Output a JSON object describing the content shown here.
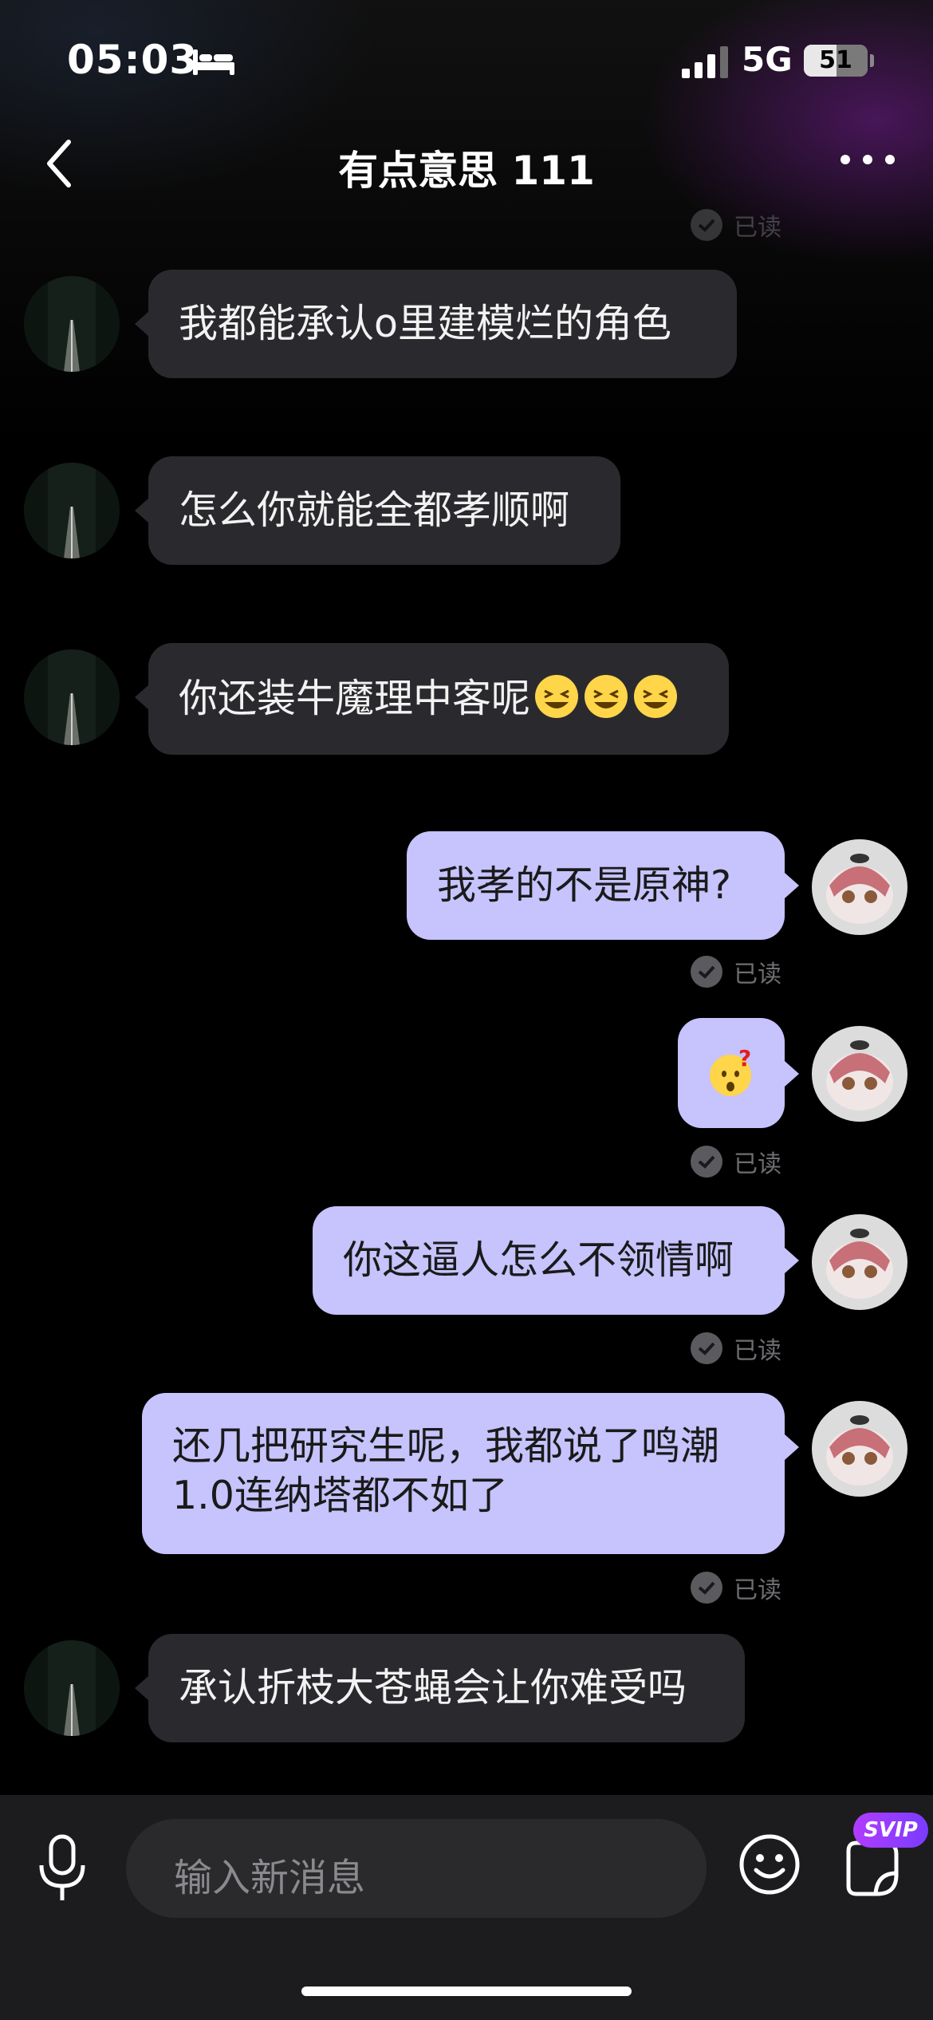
{
  "status_bar": {
    "time": "05:03",
    "network": "5G",
    "battery": "51",
    "battery_level": 0.51
  },
  "header": {
    "title": "有点意思 111"
  },
  "read_label": "已读",
  "messages": [
    {
      "side": "in",
      "text": "我都能承认o里建模烂的角色"
    },
    {
      "side": "in",
      "text": "怎么你就能全都孝顺啊"
    },
    {
      "side": "in",
      "text": "你还装牛魔理中客呢",
      "emoji": [
        "grinning-squint-icon",
        "grinning-squint-icon",
        "grinning-squint-icon"
      ]
    },
    {
      "side": "out",
      "text": "我孝的不是原神?"
    },
    {
      "side": "out",
      "text": "",
      "emoji": [
        "question-face-icon"
      ]
    },
    {
      "side": "out",
      "text": "你这逼人怎么不领情啊"
    },
    {
      "side": "out",
      "lines": [
        "还几把研究生呢，我都说了鸣潮",
        "1.0连纳塔都不如了"
      ]
    },
    {
      "side": "in",
      "text": "承认折枝大苍蝇会让你难受吗"
    }
  ],
  "input": {
    "placeholder": "输入新消息"
  },
  "badges": {
    "svip": "SVIP"
  },
  "colors": {
    "incoming_bubble": "#2a2a2e",
    "outgoing_bubble": "#c6c3fd",
    "accent": "#9b3cff"
  }
}
